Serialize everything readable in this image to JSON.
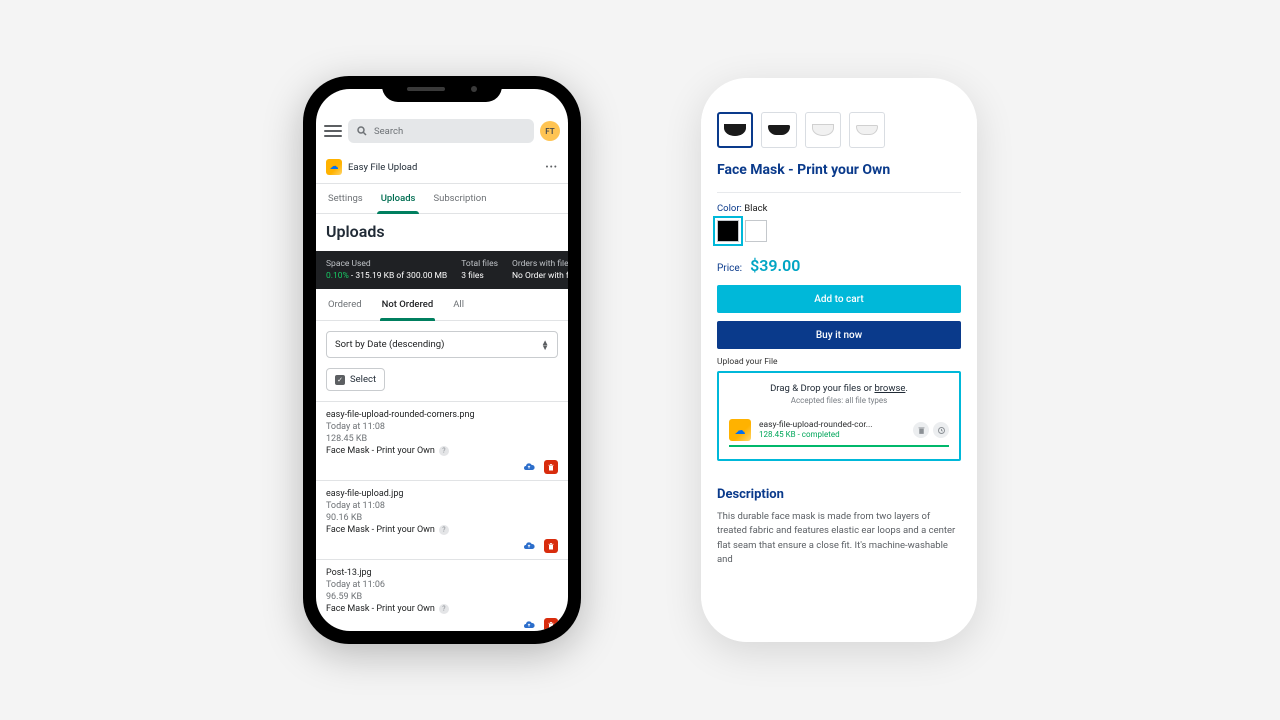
{
  "admin": {
    "search_placeholder": "Search",
    "avatar": "FT",
    "app_name": "Easy File Upload",
    "tabs": [
      "Settings",
      "Uploads",
      "Subscription"
    ],
    "page_title": "Uploads",
    "stats": {
      "space_label": "Space Used",
      "space_pct": "0.10%",
      "space_detail": " - 315.19 KB of 300.00 MB",
      "total_label": "Total files",
      "total_value": "3 files",
      "orders_label": "Orders with files",
      "orders_value": "No Order with files yet"
    },
    "subtabs": [
      "Ordered",
      "Not Ordered",
      "All"
    ],
    "sort_prefix": "Sort by ",
    "sort_value": "Date (descending)",
    "select_label": "Select",
    "files": [
      {
        "name": "easy-file-upload-rounded-corners.png",
        "when": "Today at 11:08",
        "size": "128.45 KB",
        "product": "Face Mask - Print your Own"
      },
      {
        "name": "easy-file-upload.jpg",
        "when": "Today at 11:08",
        "size": "90.16 KB",
        "product": "Face Mask - Print your Own"
      },
      {
        "name": "Post-13.jpg",
        "when": "Today at 11:06",
        "size": "96.59 KB",
        "product": "Face Mask - Print your Own"
      }
    ]
  },
  "store": {
    "title": "Face Mask - Print your Own",
    "color_label": "Color:",
    "color_value": "Black",
    "price_label": "Price:",
    "price": "$39.00",
    "add_to_cart": "Add to cart",
    "buy_now": "Buy it now",
    "upload_label": "Upload your File",
    "dz_text_a": "Drag & Drop your files or ",
    "dz_text_b": "browse",
    "dz_sub": "Accepted files: all file types",
    "upl_name": "easy-file-upload-rounded-cor...",
    "upl_status": "128.45 KB - completed",
    "desc_h": "Description",
    "desc_p": "This durable face mask is made from two layers of treated fabric and features elastic ear loops and a center flat seam that ensure a close fit. It's machine-washable and"
  }
}
